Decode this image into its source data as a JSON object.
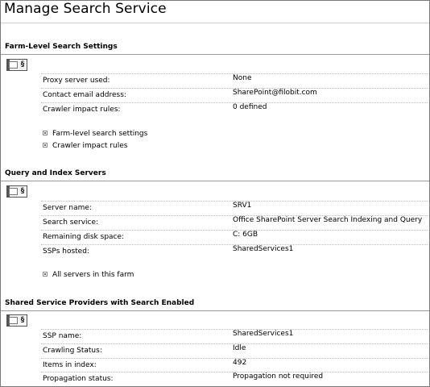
{
  "page": {
    "title": "Manage Search Service"
  },
  "sections": [
    {
      "heading": "Farm-Level Search Settings",
      "rows": [
        {
          "label": "Proxy server used:",
          "value": "None"
        },
        {
          "label": "Contact email address:",
          "value": "SharePoint@filobit.com"
        },
        {
          "label": "Crawler impact rules:",
          "value": "0 defined"
        }
      ],
      "links": [
        "Farm-level search settings",
        "Crawler impact rules"
      ]
    },
    {
      "heading": "Query and Index Servers",
      "rows": [
        {
          "label": "Server name:",
          "value": "SRV1"
        },
        {
          "label": "Search service:",
          "value": "Office SharePoint Server Search Indexing and Query"
        },
        {
          "label": "Remaining disk space:",
          "value": "C: 6GB"
        },
        {
          "label": "SSPs hosted:",
          "value": "SharedServices1"
        }
      ],
      "links": [
        "All servers in this farm"
      ]
    },
    {
      "heading": "Shared Service Providers with Search Enabled",
      "rows": [
        {
          "label": "SSP name:",
          "value": "SharedServices1"
        },
        {
          "label": "Crawling Status:",
          "value": "Idle"
        },
        {
          "label": "Items in index:",
          "value": "492"
        },
        {
          "label": "Propagation status:",
          "value": "Propagation not required"
        }
      ],
      "links": []
    }
  ]
}
